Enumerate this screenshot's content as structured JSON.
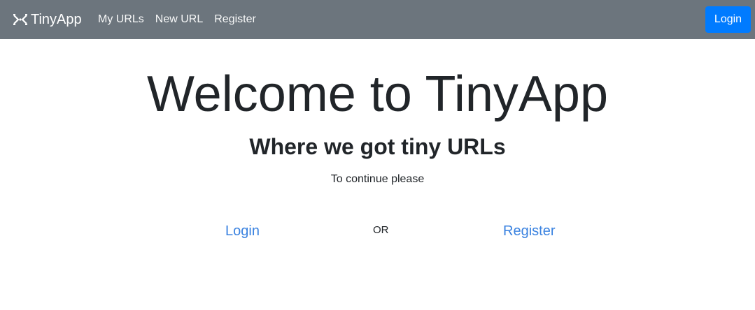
{
  "navbar": {
    "brand_icon": "shuffle-icon",
    "brand_name": "TinyApp",
    "links": [
      {
        "label": "My URLs"
      },
      {
        "label": "New URL"
      },
      {
        "label": "Register"
      }
    ],
    "login_label": "Login",
    "background_color": "#6c757d",
    "login_color": "#007bff"
  },
  "main": {
    "title": "Welcome to TinyApp",
    "subtitle": "Where we got tiny URLs",
    "prompt": "To continue please",
    "login_link": "Login",
    "or_text": "OR",
    "register_link": "Register",
    "link_color": "#3a82e0"
  }
}
